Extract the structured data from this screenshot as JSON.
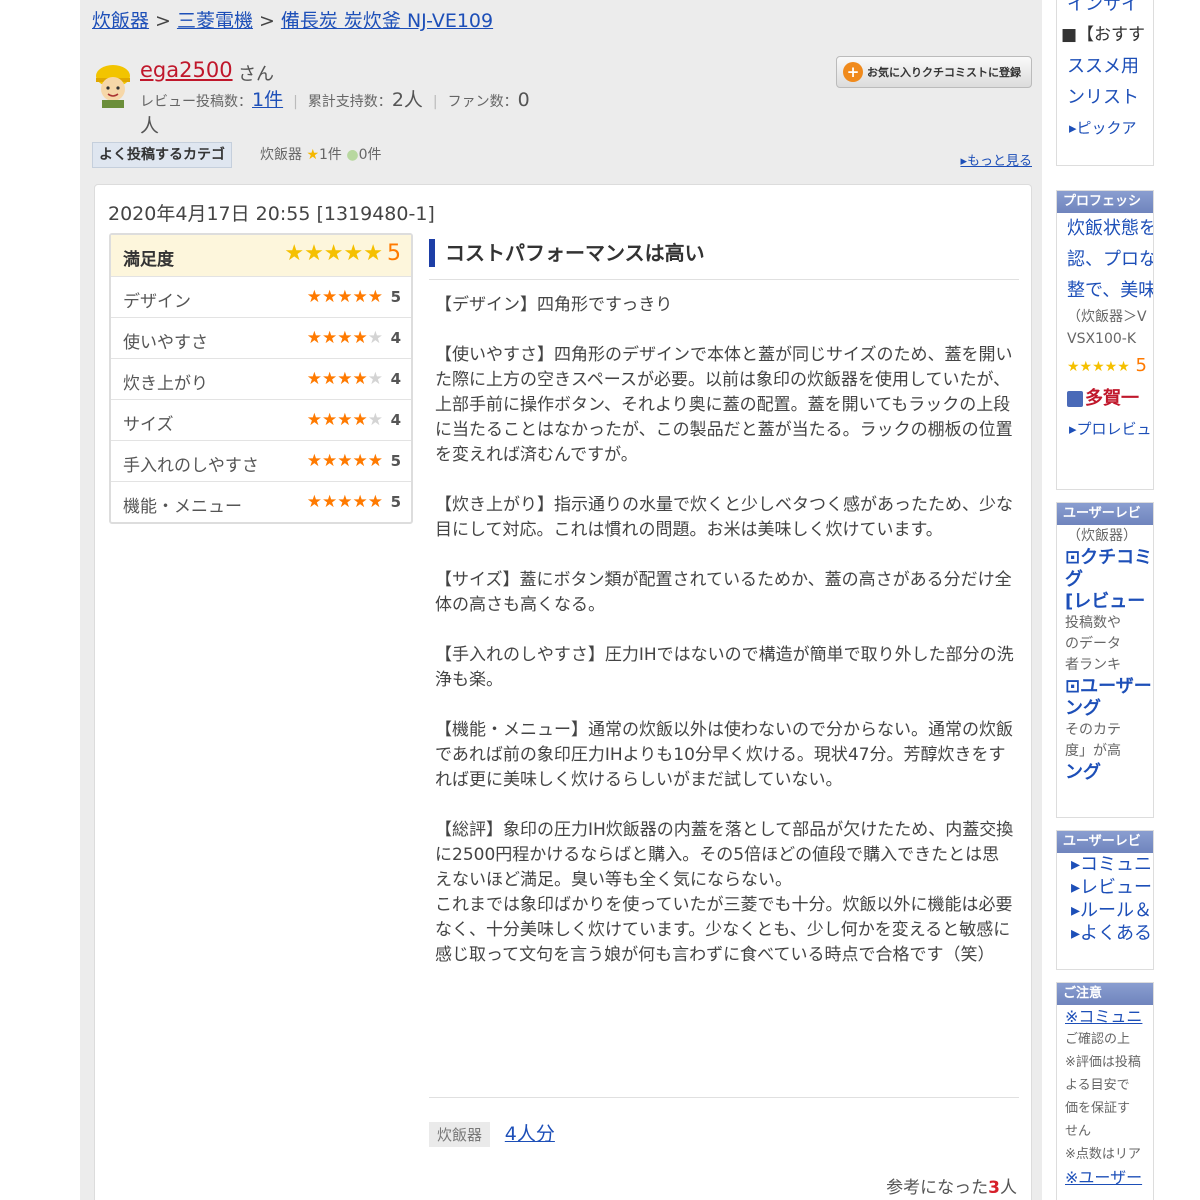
{
  "breadcrumb": {
    "items": [
      "炊飯器",
      "三菱電機",
      "備長炭 炭炊釜 NJ-VE109"
    ],
    "separator": ">"
  },
  "user": {
    "name": "ega2500",
    "suffix": "さん",
    "review_count_label": "レビュー投稿数：",
    "review_count": "1件",
    "support_label": "累計支持数：",
    "support_count": "2人",
    "fan_label": "ファン数：",
    "fan_count": "0",
    "fan_unit": "人"
  },
  "favorite_button": {
    "label": "お気に入りクチコミストに登録"
  },
  "category": {
    "label": "よく投稿するカテゴ",
    "name": "炊飯器",
    "review_count": "1件",
    "other_count": "0件",
    "more_link": "もっと見る"
  },
  "review": {
    "date": "2020年4月17日 20:55 [1319480-1]",
    "title": "コストパフォーマンスは高い",
    "ratings": [
      {
        "label": "満足度",
        "score": 5
      },
      {
        "label": "デザイン",
        "score": 5
      },
      {
        "label": "使いやすさ",
        "score": 4
      },
      {
        "label": "炊き上がり",
        "score": 4
      },
      {
        "label": "サイズ",
        "score": 4
      },
      {
        "label": "手入れのしやすさ",
        "score": 5
      },
      {
        "label": "機能・メニュー",
        "score": 5
      }
    ],
    "body": [
      "【デザイン】四角形ですっきり",
      "【使いやすさ】四角形のデザインで本体と蓋が同じサイズのため、蓋を開いた際に上方の空きスペースが必要。以前は象印の炊飯器を使用していたが、上部手前に操作ボタン、それより奥に蓋の配置。蓋を開いてもラックの上段に当たることはなかったが、この製品だと蓋が当たる。ラックの棚板の位置を変えれば済むんですが。",
      "【炊き上がり】指示通りの水量で炊くと少しベタつく感があったため、少な目にして対応。これは慣れの問題。お米は美味しく炊けています。",
      "【サイズ】蓋にボタン類が配置されているためか、蓋の高さがある分だけ全体の高さも高くなる。",
      "【手入れのしやすさ】圧力IHではないので構造が簡単で取り外した部分の洗浄も楽。",
      "【機能・メニュー】通常の炊飯以外は使わないので分からない。通常の炊飯であれば前の象印圧力IHよりも10分早く炊ける。現状47分。芳醇炊きをすれば更に美味しく炊けるらしいがまだ試していない。",
      "【総評】象印の圧力IH炊飯器の内蓋を落として部品が欠けたため、内蓋交換に2500円程かけるならばと購入。その5倍ほどの値段で購入できたとは思えないほど満足。臭い等も全く気にならない。",
      "これまでは象印ばかりを使っていたが三菱でも十分。炊飯以外に機能は必要なく、十分美味しく炊けています。少なくとも、少し何かを変えると敏感に感じ取って文句を言う娘が何も言わずに食べている時点で合格です（笑）"
    ],
    "tag": "炊飯器",
    "tag_link": "4人分",
    "helpful_prefix": "参考になった",
    "helpful_count": "3",
    "helpful_suffix": "人"
  },
  "sidebar": {
    "top_fragment": "インサイ",
    "recommend_lines": [
      "■【おすす",
      "ススメ用",
      "ンリスト"
    ],
    "pickup_link": "▸ピックア",
    "pro_header": "プロフェッシ",
    "pro_lines": [
      "炊飯状態を",
      "認、プロな",
      "整で、美味"
    ],
    "pro_breadcrumb": "（炊飯器＞V",
    "pro_model": "VSX100-K",
    "pro_score": "5",
    "pro_author": "多賀一",
    "pro_review_link": "▸プロレビュ",
    "user_header": "ユーザーレビ",
    "user_category": "（炊飯器）",
    "user_lines": [
      "⊡クチコミ",
      "グ",
      "[レビュー",
      "投稿数や",
      "のデータ",
      "者ランキ",
      "⊡ユーザー",
      "ング",
      "そのカテ",
      "度」が高",
      "ング"
    ],
    "user2_header": "ユーザーレビ",
    "user2_links": [
      "▸コミュニ",
      "▸レビュー",
      "▸ルール＆",
      "▸よくある"
    ],
    "notice_header": "ご注意",
    "notice_lines": [
      "※コミュニ",
      "ご確認の上",
      "※評価は投稿",
      "よる目安で",
      "価を保証す",
      "せん",
      "※点数はリア",
      "※ユーザー"
    ]
  }
}
